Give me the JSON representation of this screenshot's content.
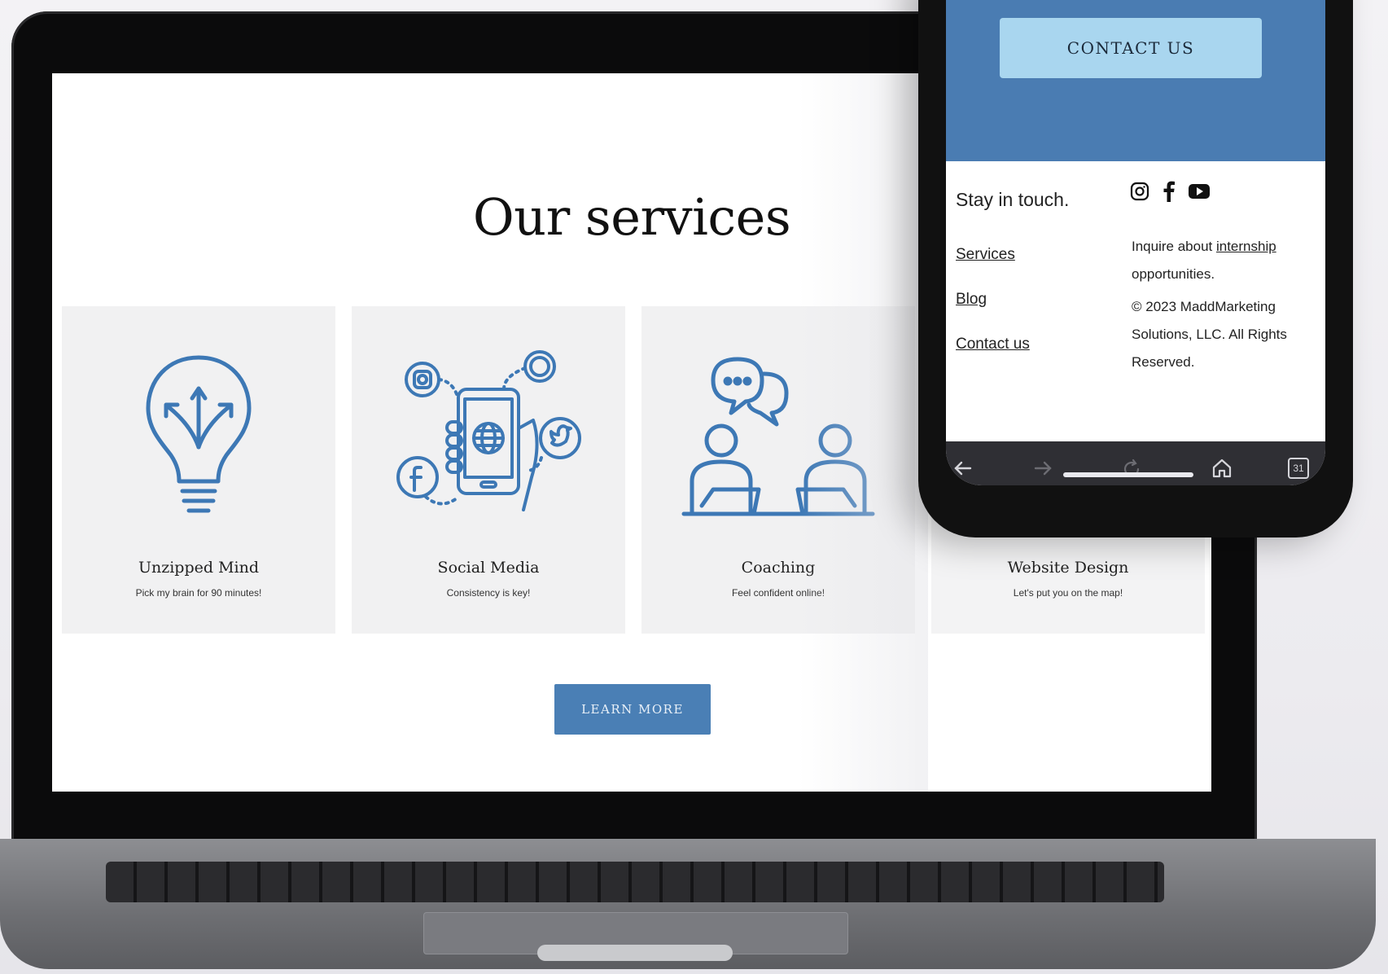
{
  "page": {
    "title": "Our services",
    "learn_more": "LEARN MORE"
  },
  "services": [
    {
      "title": "Unzipped Mind",
      "subtitle": "Pick my brain for 90 minutes!",
      "icon": "lightbulb-icon"
    },
    {
      "title": "Social Media",
      "subtitle": "Consistency is key!",
      "icon": "social-phone-icon"
    },
    {
      "title": "Coaching",
      "subtitle": "Feel confident online!",
      "icon": "coaching-icon"
    },
    {
      "title": "Website Design",
      "subtitle": "Let's put you on the map!",
      "icon": "website-icon"
    }
  ],
  "phone": {
    "contact_button": "CONTACT US",
    "stay": "Stay in touch.",
    "links": [
      "Services",
      "Blog",
      "Contact us"
    ],
    "inquire_prefix": "Inquire about ",
    "inquire_link": "internship",
    "inquire_suffix": "opportunities.",
    "copyright_line1": "© 2023 MaddMarketing",
    "copyright_line2": "Solutions, LLC. All Rights",
    "copyright_line3": "Reserved.",
    "nav_date": "31"
  },
  "colors": {
    "accent": "#4a7fb5",
    "light_blue": "#a9d6ef",
    "card_bg": "#f1f1f2"
  }
}
